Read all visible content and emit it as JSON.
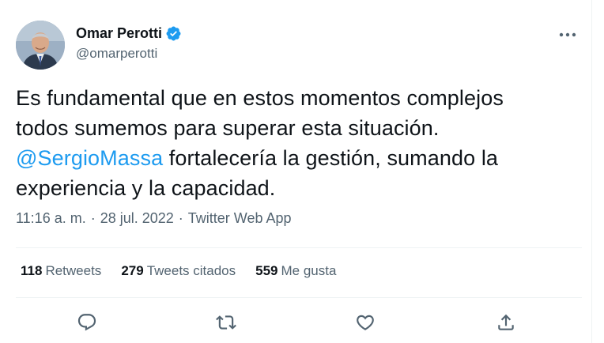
{
  "author": {
    "display_name": "Omar Perotti",
    "handle": "@omarperotti",
    "verified": true
  },
  "tweet": {
    "line1": "Es fundamental que en estos momentos complejos",
    "line2": "todos sumemos para superar esta situación.",
    "mention": "@SergioMassa",
    "line3_rest": " fortalecería la gestión, sumando la",
    "line4": "experiencia y la capacidad."
  },
  "meta": {
    "time": "11:16 a. m.",
    "separator1": "·",
    "date": "28 jul. 2022",
    "separator2": "·",
    "source": "Twitter Web App"
  },
  "stats": [
    {
      "count": "118",
      "label": "Retweets"
    },
    {
      "count": "279",
      "label": "Tweets citados"
    },
    {
      "count": "559",
      "label": "Me gusta"
    }
  ],
  "icons": {
    "more": "more-horizontal-icon",
    "reply": "reply-icon",
    "retweet": "retweet-icon",
    "like": "heart-icon",
    "share": "share-icon",
    "verified": "verified-badge-icon"
  },
  "colors": {
    "accent": "#1d9bf0",
    "text": "#0f1419",
    "secondary": "#536471",
    "divider": "#eff3f4"
  }
}
